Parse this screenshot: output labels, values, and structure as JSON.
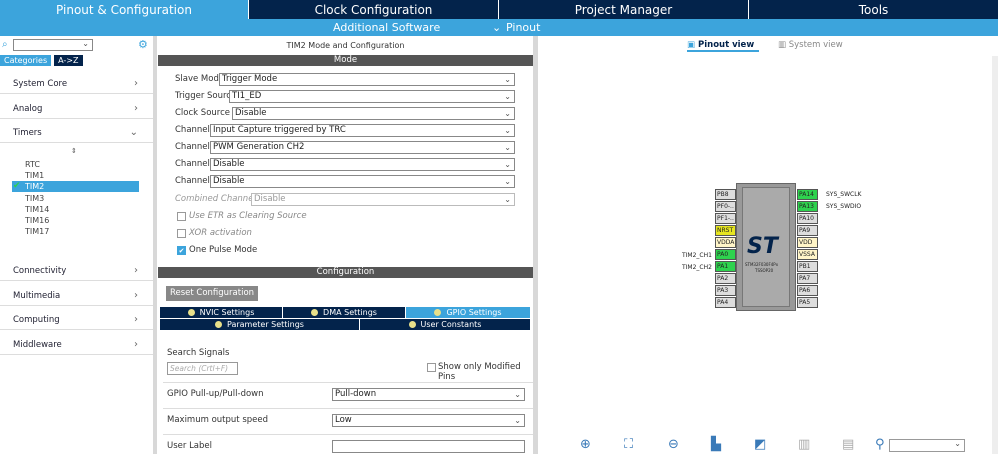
{
  "top_tabs": [
    "Pinout & Configuration",
    "Clock Configuration",
    "Project Manager",
    "Tools"
  ],
  "subbar": {
    "additional": "Additional Software",
    "pinout": "Pinout"
  },
  "left": {
    "cat_tabs": [
      "Categories",
      "A->Z"
    ],
    "sections": [
      "System Core",
      "Analog",
      "Timers"
    ],
    "timers": [
      "RTC",
      "TIM1",
      "TIM2",
      "TIM3",
      "TIM14",
      "TIM16",
      "TIM17"
    ],
    "sections_bottom": [
      "Connectivity",
      "Multimedia",
      "Computing",
      "Middleware"
    ]
  },
  "mid": {
    "title": "TIM2 Mode and Configuration",
    "mode_bar": "Mode",
    "fields": [
      {
        "label": "Slave Mode",
        "value": "Trigger Mode"
      },
      {
        "label": "Trigger Source",
        "value": "TI1_ED"
      },
      {
        "label": "Clock Source",
        "value": "Disable"
      },
      {
        "label": "Channel1",
        "value": "Input Capture triggered by TRC"
      },
      {
        "label": "Channel2",
        "value": "PWM Generation CH2"
      },
      {
        "label": "Channel3",
        "value": "Disable"
      },
      {
        "label": "Channel4",
        "value": "Disable"
      },
      {
        "label": "Combined Channels",
        "value": "Disable"
      }
    ],
    "checks": [
      {
        "label": "Use ETR as Clearing Source",
        "checked": false
      },
      {
        "label": "XOR activation",
        "checked": false
      },
      {
        "label": "One Pulse Mode",
        "checked": true
      }
    ],
    "config_bar": "Configuration",
    "reset_button": "Reset Configuration",
    "settings_tabs": [
      "NVIC Settings",
      "DMA Settings",
      "GPIO Settings",
      "Parameter Settings",
      "User Constants"
    ],
    "search_label": "Search Signals",
    "search_placeholder": "Search (Crtl+F)",
    "show_modified": "Show only Modified Pins",
    "params": [
      {
        "label": "GPIO Pull-up/Pull-down",
        "value": "Pull-down"
      },
      {
        "label": "Maximum output speed",
        "value": "Low"
      },
      {
        "label": "User Label",
        "value": ""
      }
    ]
  },
  "right": {
    "view_tabs": [
      "Pinout view",
      "System view"
    ],
    "chip_name": "STM32F030F4Px",
    "chip_pkg": "TSSOP20",
    "left_pins": [
      "PB8",
      "PF0-..",
      "PF1-..",
      "NRST",
      "VDDA",
      "PA0",
      "PA1",
      "PA2",
      "PA3",
      "PA4"
    ],
    "right_pins": [
      "PA14",
      "PA13",
      "PA10",
      "PA9",
      "VDD",
      "VSSA",
      "PB1",
      "PA7",
      "PA6",
      "PA5"
    ],
    "left_labels": {
      "PA0": "TIM2_CH1",
      "PA1": "TIM2_CH2"
    },
    "right_labels": {
      "PA14": "SYS_SWCLK",
      "PA13": "SYS_SWDIO"
    }
  }
}
